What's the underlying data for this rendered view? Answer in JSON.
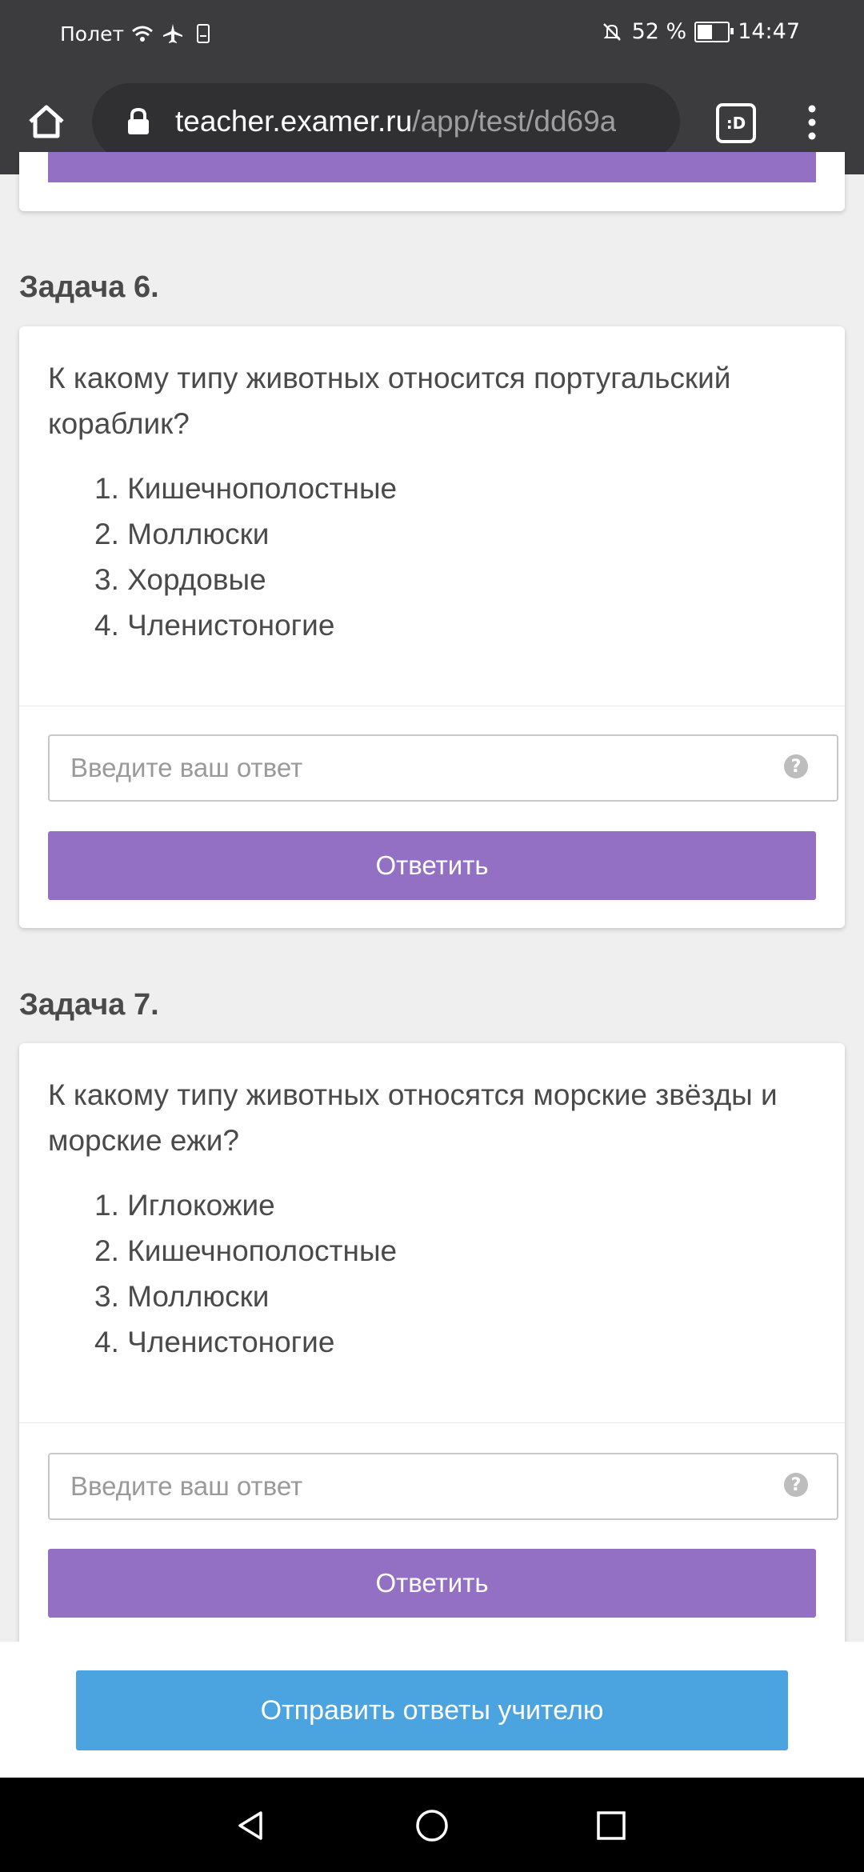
{
  "status_bar": {
    "carrier": "Полет",
    "battery": "52 %",
    "time": "14:47"
  },
  "browser": {
    "url_host": "teacher.examer.ru",
    "url_path": "/app/test/dd69a",
    "tabs_label": ":D"
  },
  "tasks": [
    {
      "heading": "Задача 6.",
      "question": "К какому типу животных относится португальский кораблик?",
      "options": [
        "1. Кишечнополостные",
        "2. Моллюски",
        "3. Хордовые",
        "4. Членистоногие"
      ],
      "input_placeholder": "Введите ваш ответ",
      "input_value": "",
      "help_glyph": "?",
      "answer_label": "Ответить"
    },
    {
      "heading": "Задача 7.",
      "question": "К какому типу животных относятся морские звёзды и морские ежи?",
      "options": [
        "1. Иглокожие",
        "2. Кишечнополостные",
        "3. Моллюски",
        "4. Членистоногие"
      ],
      "input_placeholder": "Введите ваш ответ",
      "input_value": "",
      "help_glyph": "?",
      "answer_label": "Ответить"
    }
  ],
  "submit": {
    "label": "Отправить ответы учителю"
  },
  "colors": {
    "accent_purple": "#9370c4",
    "submit_blue": "#4ba3df",
    "chrome_dark": "#3c3c3e"
  },
  "battery_level": 0.52,
  "icons": [
    "wifi-icon",
    "airplane-icon",
    "sim-icon",
    "mute-icon",
    "battery-icon",
    "home-icon",
    "lock-icon",
    "menu-icon",
    "help-icon",
    "back-icon",
    "home-nav-icon",
    "recents-icon"
  ]
}
